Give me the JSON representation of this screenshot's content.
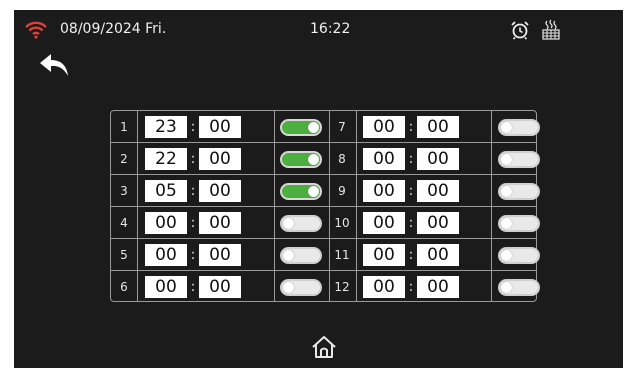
{
  "status_bar": {
    "date": "08/09/2024 Fri.",
    "time": "16:22",
    "icons": [
      "wifi-icon",
      "alarm-clock-icon",
      "heating-icon"
    ]
  },
  "nav": {
    "back_icon": "back-arrow-icon",
    "home_icon": "home-icon"
  },
  "colors": {
    "background": "#1b1b1b",
    "accent_on": "#4caf3f",
    "toggle_off": "#e9e9e9",
    "wifi": "#e0403a"
  },
  "schedule": [
    {
      "index": "1",
      "hour": "23",
      "minute": "00",
      "enabled": true
    },
    {
      "index": "2",
      "hour": "22",
      "minute": "00",
      "enabled": true
    },
    {
      "index": "3",
      "hour": "05",
      "minute": "00",
      "enabled": true
    },
    {
      "index": "4",
      "hour": "00",
      "minute": "00",
      "enabled": false
    },
    {
      "index": "5",
      "hour": "00",
      "minute": "00",
      "enabled": false
    },
    {
      "index": "6",
      "hour": "00",
      "minute": "00",
      "enabled": false
    },
    {
      "index": "7",
      "hour": "00",
      "minute": "00",
      "enabled": false
    },
    {
      "index": "8",
      "hour": "00",
      "minute": "00",
      "enabled": false
    },
    {
      "index": "9",
      "hour": "00",
      "minute": "00",
      "enabled": false
    },
    {
      "index": "10",
      "hour": "00",
      "minute": "00",
      "enabled": false
    },
    {
      "index": "11",
      "hour": "00",
      "minute": "00",
      "enabled": false
    },
    {
      "index": "12",
      "hour": "00",
      "minute": "00",
      "enabled": false
    }
  ],
  "separator": ":"
}
